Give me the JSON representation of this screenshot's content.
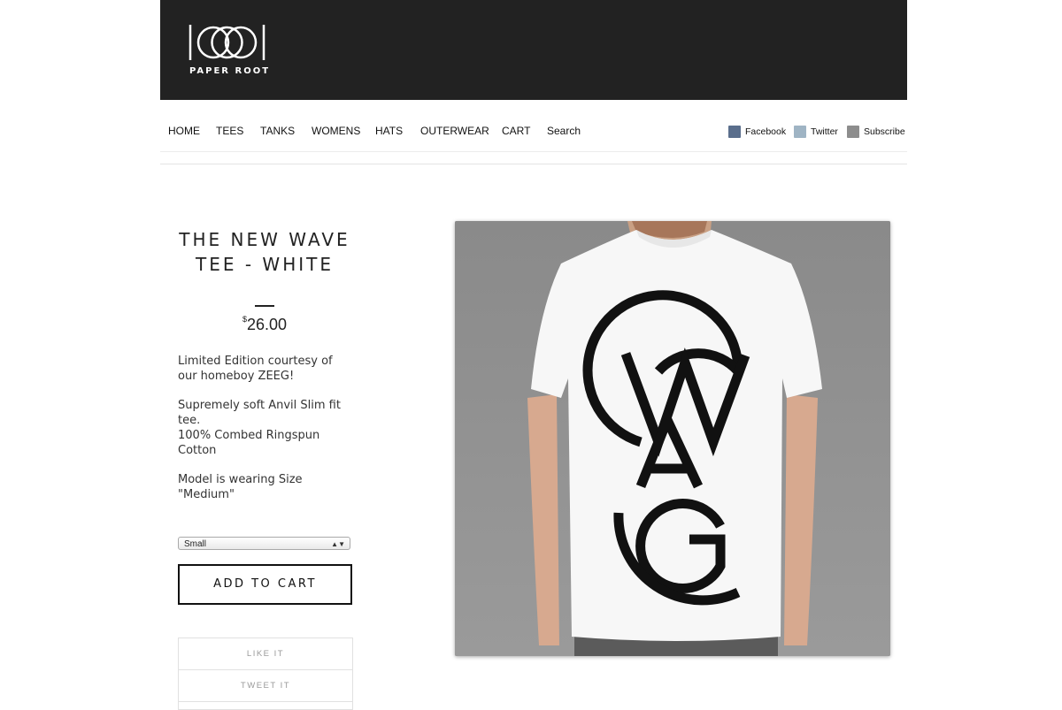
{
  "brand": {
    "name": "PAPER ROOT"
  },
  "nav": {
    "items": [
      {
        "label": "HOME"
      },
      {
        "label": "TEES"
      },
      {
        "label": "TANKS"
      },
      {
        "label": "WOMENS"
      },
      {
        "label": "HATS"
      },
      {
        "label": "OUTERWEAR"
      },
      {
        "label": "CART"
      },
      {
        "label": "Search"
      }
    ],
    "social": [
      {
        "label": "Facebook",
        "icon": "facebook-icon"
      },
      {
        "label": "Twitter",
        "icon": "twitter-icon"
      },
      {
        "label": "Subscribe",
        "icon": "rss-icon"
      }
    ]
  },
  "product": {
    "title": "THE NEW WAVE TEE - WHITE",
    "currency_symbol": "$",
    "price": "26.00",
    "description": [
      "Limited Edition courtesy of our homeboy ZEEG!",
      "Supremely soft Anvil Slim fit tee.\n100% Combed Ringspun Cotton",
      "Model is wearing Size \"Medium\""
    ],
    "size_selected": "Small",
    "add_to_cart_label": "ADD TO CART",
    "share": [
      {
        "label": "LIKE IT"
      },
      {
        "label": "TWEET IT"
      }
    ]
  },
  "colors": {
    "header_bg": "#222222",
    "photo_bg": "#8e8e8e",
    "accent": "#111111"
  }
}
